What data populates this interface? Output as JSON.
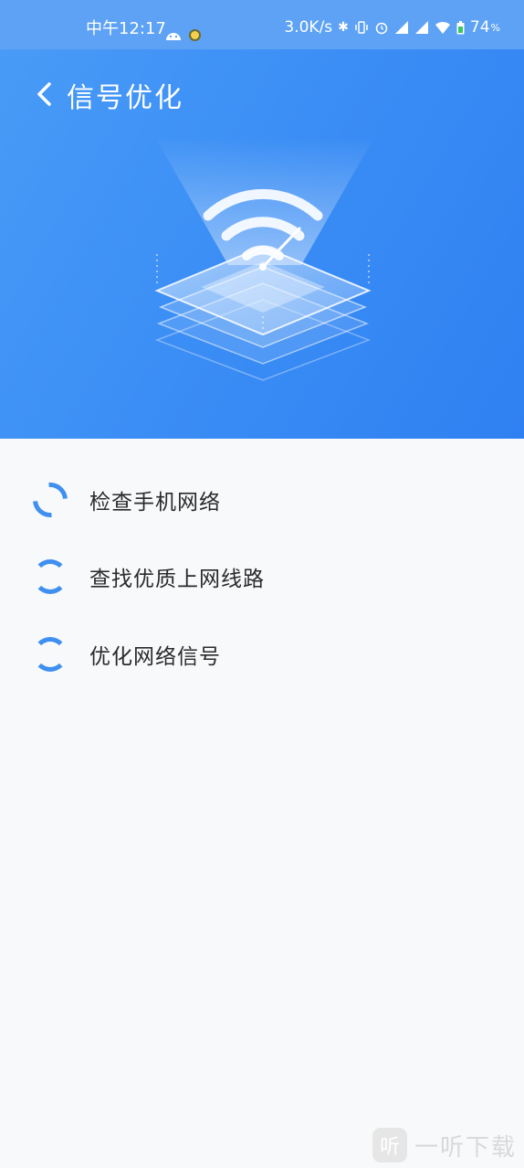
{
  "status_bar": {
    "time": "中午12:17",
    "net_speed": "3.0K/s",
    "battery": "74",
    "battery_unit": "%"
  },
  "header": {
    "title": "信号优化"
  },
  "steps": [
    {
      "label": "检查手机网络"
    },
    {
      "label": "查找优质上网线路"
    },
    {
      "label": "优化网络信号"
    }
  ],
  "watermark": {
    "logo_char": "听",
    "text": "一听下载"
  },
  "colors": {
    "header_blue": "#3c8ff5",
    "spinner_blue": "#3f8ff0",
    "background": "#f7f9fb"
  }
}
